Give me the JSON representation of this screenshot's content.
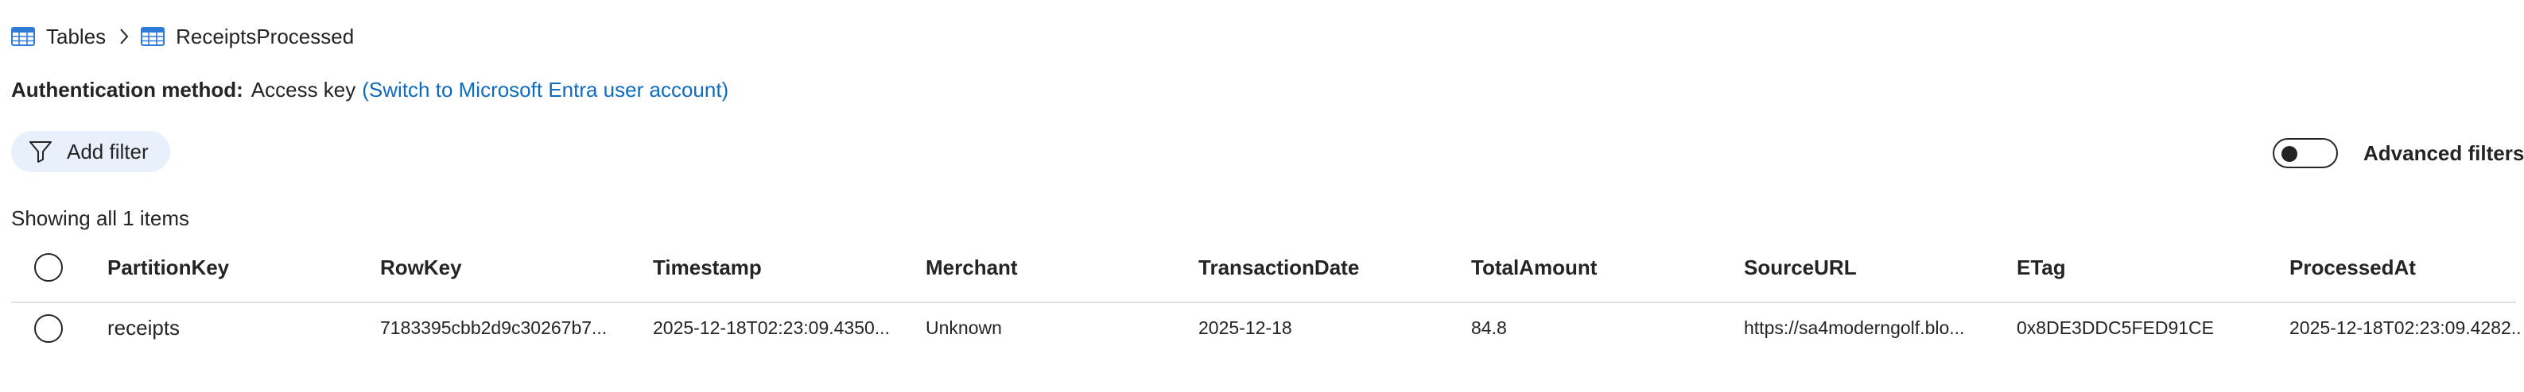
{
  "breadcrumb": {
    "items": [
      {
        "label": "Tables",
        "icon": "table-icon"
      },
      {
        "label": "ReceiptsProcessed",
        "icon": "table-icon"
      }
    ],
    "separator_icon": "chevron-right-icon"
  },
  "auth": {
    "label": "Authentication method:",
    "value": "Access key",
    "switch_link": "(Switch to Microsoft Entra user account)"
  },
  "filter": {
    "add_filter_label": "Add filter",
    "advanced_filters_label": "Advanced filters",
    "advanced_filters_on": false
  },
  "results": {
    "summary": "Showing all 1 items"
  },
  "table": {
    "columns": [
      "PartitionKey",
      "RowKey",
      "Timestamp",
      "Merchant",
      "TransactionDate",
      "TotalAmount",
      "SourceURL",
      "ETag",
      "ProcessedAt"
    ],
    "rows": [
      {
        "cells": [
          "receipts",
          "7183395cbb2d9c30267b7...",
          "2025-12-18T02:23:09.4350...",
          "Unknown",
          "2025-12-18",
          "84.8",
          "https://sa4moderngolf.blo...",
          "0x8DE3DDC5FED91CE",
          "2025-12-18T02:23:09.4282..."
        ]
      }
    ]
  },
  "colors": {
    "accent": "#0f6cbd",
    "text": "#242424",
    "pill_bg": "#e8f1fb",
    "divider": "#e0e0e0",
    "table_icon_blue": "#2f7bd8"
  }
}
